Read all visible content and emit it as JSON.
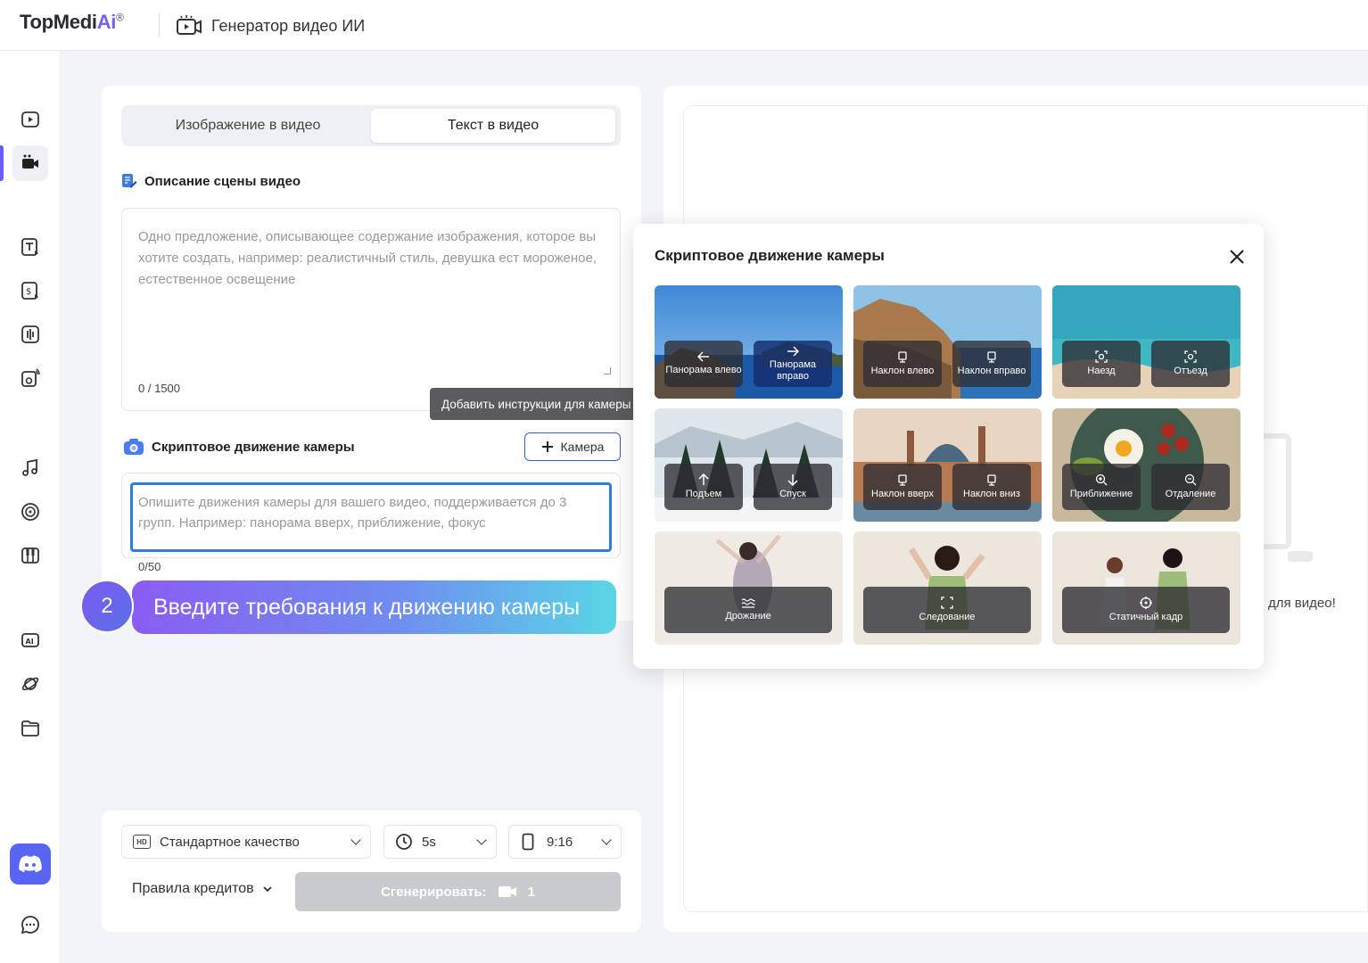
{
  "app": {
    "logo_main": "TopMedi",
    "logo_ai": "Ai",
    "logo_reg": "®",
    "title": "Генератор видео ИИ"
  },
  "sidebar": {
    "icons": [
      "video-icon",
      "camera-video-icon",
      "text-icon",
      "dollar-icon",
      "voice-icon",
      "speaker-icon",
      "music-icon",
      "vinyl-icon",
      "piano-icon",
      "ai-icon",
      "planet-icon",
      "folder-icon"
    ],
    "active": "camera-video-icon",
    "discord": "discord-icon",
    "chat": "chat-icon"
  },
  "tabs": {
    "image_to_video": "Изображение в видео",
    "text_to_video": "Текст в видео"
  },
  "scene": {
    "title": "Описание сцены видео",
    "placeholder": "Одно предложение, описывающее содержание изображения, которое вы хотите создать, например: реалистичный стиль, девушка ест мороженое, естественное освещение",
    "counter": "0 / 1500"
  },
  "camera": {
    "title": "Скриптовое движение камеры",
    "button": "Камера",
    "tooltip": "Добавить инструкции для камеры",
    "placeholder": "Опишите движения камеры для вашего видео, поддерживается до 3 групп. Например: панорама вверх, приближение, фокус",
    "counter": "0/50"
  },
  "guide": {
    "step": "2",
    "text": "Введите требования к движению камеры"
  },
  "bottom": {
    "quality": "Стандартное качество",
    "quality_badge": "HD",
    "duration": "5s",
    "ratio": "9:16",
    "credits": "Правила кредитов",
    "generate": "Сгенерировать:",
    "generate_cost": "1"
  },
  "right": {
    "hint": "для видео!"
  },
  "popup": {
    "title": "Скриптовое движение камеры",
    "cells": [
      {
        "options": [
          "Панорама влево",
          "Панорама вправо"
        ],
        "icons": [
          "arrow-left-icon",
          "arrow-right-icon"
        ]
      },
      {
        "options": [
          "Наклон влево",
          "Наклон вправо"
        ],
        "icons": [
          "tilt-left-icon",
          "tilt-right-icon"
        ]
      },
      {
        "options": [
          "Наезд",
          "Отъезд"
        ],
        "icons": [
          "focus-icon",
          "focus-icon"
        ]
      },
      {
        "options": [
          "Подъем",
          "Спуск"
        ],
        "icons": [
          "arrow-up-icon",
          "arrow-down-icon"
        ]
      },
      {
        "options": [
          "Наклон вверх",
          "Наклон вниз"
        ],
        "icons": [
          "tilt-up-icon",
          "tilt-down-icon"
        ]
      },
      {
        "options": [
          "Приближение",
          "Отдаление"
        ],
        "icons": [
          "zoom-in-icon",
          "zoom-out-icon"
        ]
      },
      {
        "options": [
          "Дрожание"
        ],
        "icons": [
          "shake-icon"
        ]
      },
      {
        "options": [
          "Следование"
        ],
        "icons": [
          "follow-icon"
        ]
      },
      {
        "options": [
          "Статичный кадр"
        ],
        "icons": [
          "static-icon"
        ]
      }
    ]
  }
}
